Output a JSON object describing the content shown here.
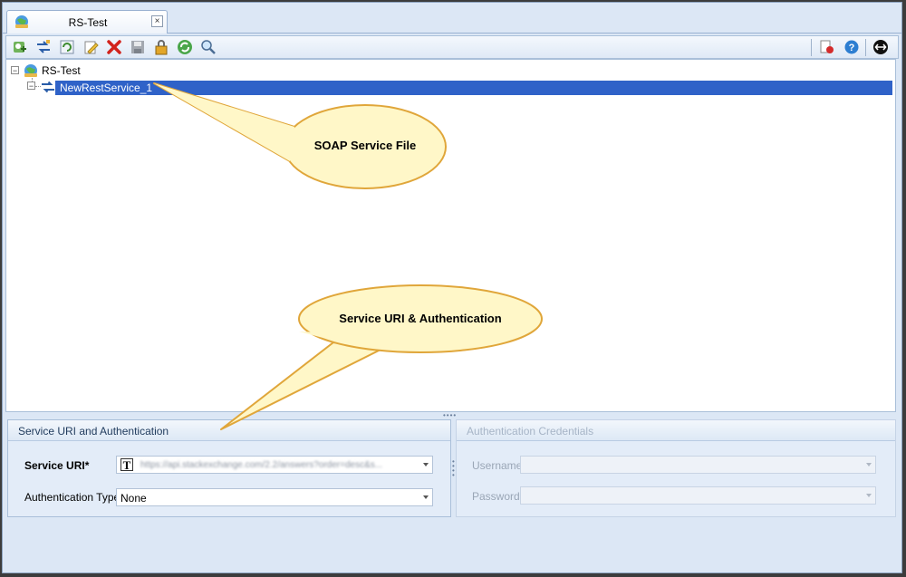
{
  "tab": {
    "title": "RS-Test",
    "close": "×",
    "icon": "project-globe-icon"
  },
  "toolbar": {
    "left_icons": [
      "add-project-icon",
      "add-service-icon",
      "refresh-icon",
      "edit-icon",
      "delete-icon",
      "save-icon",
      "lock-icon",
      "sync-icon",
      "search-icon"
    ],
    "right_icons": [
      "record-icon",
      "help-icon",
      "exit-icon"
    ]
  },
  "tree": {
    "root": {
      "label": "RS-Test",
      "expander": "−"
    },
    "child": {
      "label": "NewRestService_1",
      "expander": "−"
    }
  },
  "callouts": {
    "top": "SOAP Service File",
    "bottom": "Service URI & Authentication"
  },
  "left_panel": {
    "title": "Service URI and Authentication",
    "service_uri_label": "Service URI*",
    "service_uri_value": "https://api.stackexchange.com/2.2/answers?order=desc&s...",
    "service_uri_type_icon": "T",
    "auth_type_label": "Authentication Type",
    "auth_type_value": "None"
  },
  "right_panel": {
    "title": "Authentication Credentials",
    "username_label": "Username",
    "password_label": "Password"
  },
  "colors": {
    "selection": "#2f62c8",
    "callout_fill": "#fff7c8",
    "callout_border": "#e0a63a",
    "frame_bg": "#dce7f5"
  }
}
